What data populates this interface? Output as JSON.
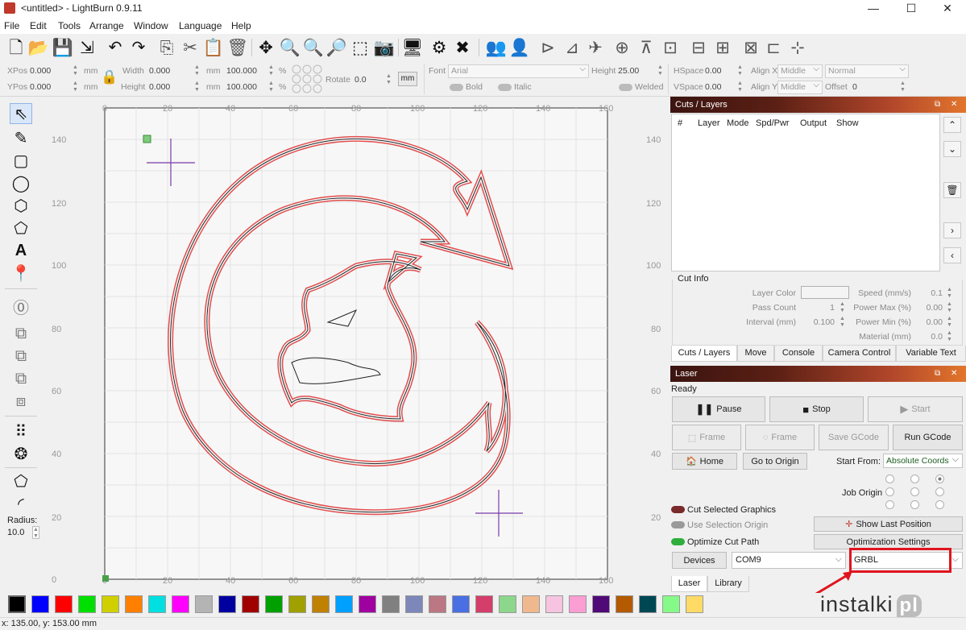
{
  "window": {
    "title": "<untitled> - LightBurn 0.9.11",
    "minimize": "—",
    "maximize": "☐",
    "close": "✕"
  },
  "menu": [
    "File",
    "Edit",
    "Tools",
    "Arrange",
    "Window",
    "Language",
    "Help"
  ],
  "toolbar_icons": [
    "new-file-icon",
    "open-file-icon",
    "save-icon",
    "import-icon",
    "undo-icon",
    "redo-icon",
    "copy-icon",
    "cut-icon",
    "paste-icon",
    "delete-icon",
    "move-icon",
    "zoom-in-icon",
    "zoom-out-icon",
    "zoom-fit-icon",
    "frame-selection-icon",
    "camera-icon",
    "monitor-icon",
    "settings-icon",
    "tools-icon",
    "group-icon",
    "ungroup-icon",
    "mirror-horizontal-icon",
    "mirror-vertical-icon",
    "send-icon",
    "center-icon",
    "align-icon",
    "distribute-icon",
    "align-h-icon",
    "align-v-icon",
    "space-icon",
    "dock-icon"
  ],
  "props": {
    "xpos_label": "XPos",
    "xpos": "0.000",
    "ypos_label": "YPos",
    "ypos": "0.000",
    "unit": "mm",
    "width_label": "Width",
    "width": "0.000",
    "height_label": "Height",
    "height": "0.000",
    "scale_x": "100.000",
    "scale_y": "100.000",
    "pct": "%",
    "rotate_label": "Rotate",
    "rotate": "0.0",
    "mm_button": "mm",
    "font_label": "Font",
    "font": "Arial",
    "bold": "Bold",
    "italic": "Italic",
    "text_height_label": "Height",
    "text_height": "25.00",
    "welded": "Welded",
    "hspace_label": "HSpace",
    "hspace": "0.00",
    "vspace_label": "VSpace",
    "vspace": "0.00",
    "alignx_label": "Align X",
    "alignx": "Middle",
    "aligny_label": "Align Y",
    "aligny": "Middle",
    "normal": "Normal",
    "offset_label": "Offset",
    "offset": "0"
  },
  "left_tools": [
    "select-icon",
    "pencil-icon",
    "rectangle-icon",
    "ellipse-icon",
    "polygon-icon",
    "pentagon-icon",
    "text-icon",
    "position-icon",
    "offset-icon",
    "weld-icon",
    "boolean-union-icon",
    "boolean-subtract-icon",
    "boolean-intersect-icon",
    "grid-array-icon",
    "circular-array-icon",
    "corner-icon",
    "radius-icon"
  ],
  "radius": {
    "label": "Radius:",
    "value": "10.0"
  },
  "ruler": {
    "top": [
      "0",
      "20",
      "40",
      "60",
      "80",
      "100",
      "120",
      "140",
      "160"
    ],
    "left": [
      "140",
      "120",
      "100",
      "80",
      "60",
      "40",
      "20",
      "0"
    ]
  },
  "cuts": {
    "title": "Cuts / Layers",
    "columns": [
      "#",
      "Layer",
      "Mode",
      "Spd/Pwr",
      "Output",
      "Show"
    ]
  },
  "cutinfo": {
    "title": "Cut Info",
    "layer_color": "Layer Color",
    "pass_count_label": "Pass Count",
    "pass_count": "1",
    "interval_label": "Interval (mm)",
    "interval": "0.100",
    "speed_label": "Speed (mm/s)",
    "speed": "0.1",
    "power_max_label": "Power Max (%)",
    "power_max": "0.00",
    "power_min_label": "Power Min (%)",
    "power_min": "0.00",
    "material_label": "Material (mm)",
    "material": "0.0"
  },
  "tabs1": [
    "Cuts / Layers",
    "Move",
    "Console",
    "Camera Control",
    "Variable Text"
  ],
  "laser": {
    "title": "Laser",
    "status": "Ready",
    "pause": "Pause",
    "stop": "Stop",
    "start": "Start",
    "frame1": "Frame",
    "frame2": "Frame",
    "save_gcode": "Save GCode",
    "run_gcode": "Run GCode",
    "home": "Home",
    "go_to_origin": "Go to Origin",
    "start_from_label": "Start From:",
    "start_from": "Absolute Coords",
    "job_origin": "Job Origin",
    "cut_selected": "Cut Selected Graphics",
    "use_selection_origin": "Use Selection Origin",
    "show_last_position": "Show Last Position",
    "optimize_cut_path": "Optimize Cut Path",
    "optimization_settings": "Optimization Settings",
    "devices": "Devices",
    "port": "COM9",
    "device": "GRBL"
  },
  "tabs2": [
    "Laser",
    "Library"
  ],
  "palette": [
    "#000000",
    "#0000ff",
    "#ff0000",
    "#00e000",
    "#d0d000",
    "#ff8000",
    "#00e0e0",
    "#ff00ff",
    "#b4b4b4",
    "#0000a0",
    "#a00000",
    "#00a000",
    "#a0a000",
    "#c08000",
    "#00a0ff",
    "#a000a0",
    "#808080",
    "#7d87b9",
    "#bb7784",
    "#4a6fe3",
    "#d33f6a",
    "#8cd78c",
    "#f0b98d",
    "#f6c4e1",
    "#fa9ed4",
    "#500a78",
    "#b45a00",
    "#004754",
    "#86fa88",
    "#ffdb66"
  ],
  "status": "x: 135.00, y: 153.00 mm",
  "watermark": "instalki",
  "watermark_suffix": "pl"
}
